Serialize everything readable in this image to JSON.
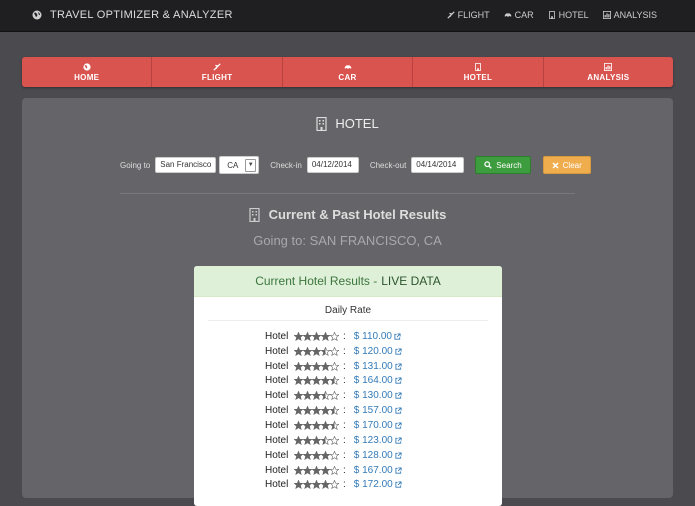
{
  "app": {
    "brand": "TRAVEL OPTIMIZER & ANALYZER",
    "top_nav": [
      {
        "label": "FLIGHT",
        "icon": "plane-icon"
      },
      {
        "label": "CAR",
        "icon": "car-icon"
      },
      {
        "label": "HOTEL",
        "icon": "building-icon"
      },
      {
        "label": "ANALYSIS",
        "icon": "bar-chart-icon"
      }
    ]
  },
  "main_nav": [
    {
      "label": "HOME",
      "icon": "globe-icon"
    },
    {
      "label": "FLIGHT",
      "icon": "plane-icon"
    },
    {
      "label": "CAR",
      "icon": "car-icon"
    },
    {
      "label": "HOTEL",
      "icon": "building-icon"
    },
    {
      "label": "ANALYSIS",
      "icon": "bar-chart-icon"
    }
  ],
  "page": {
    "title": "HOTEL",
    "results_title": "Current & Past Hotel Results",
    "going_to": "Going to: SAN FRANCISCO, CA"
  },
  "search": {
    "going_to_label": "Going to",
    "city_value": "San Francisco",
    "state_value": "CA",
    "checkin_label": "Check-in",
    "checkin_value": "04/12/2014",
    "checkout_label": "Check-out",
    "checkout_value": "04/14/2014",
    "search_button": "Search",
    "clear_button": "Clear"
  },
  "results": {
    "header_prefix": "Current Hotel Results - ",
    "header_live": "LIVE DATA",
    "column_label": "Daily Rate",
    "rows": [
      {
        "name": "Hotel",
        "stars": 4,
        "price": "$ 110.00"
      },
      {
        "name": "Hotel",
        "stars": 3.5,
        "price": "$ 120.00"
      },
      {
        "name": "Hotel",
        "stars": 4,
        "price": "$ 131.00"
      },
      {
        "name": "Hotel",
        "stars": 4.5,
        "price": "$ 164.00"
      },
      {
        "name": "Hotel",
        "stars": 3.5,
        "price": "$ 130.00"
      },
      {
        "name": "Hotel",
        "stars": 4.5,
        "price": "$ 157.00"
      },
      {
        "name": "Hotel",
        "stars": 4.5,
        "price": "$ 170.00"
      },
      {
        "name": "Hotel",
        "stars": 3.5,
        "price": "$ 123.00"
      },
      {
        "name": "Hotel",
        "stars": 4,
        "price": "$ 128.00"
      },
      {
        "name": "Hotel",
        "stars": 4,
        "price": "$ 167.00"
      },
      {
        "name": "Hotel",
        "stars": 4,
        "price": "$ 172.00"
      }
    ]
  },
  "colors": {
    "accent_red": "#d9534f",
    "search_green": "#3d9c3d",
    "clear_orange": "#f0ad4e",
    "link_blue": "#337ab7",
    "success_bg": "#dff0d8"
  }
}
